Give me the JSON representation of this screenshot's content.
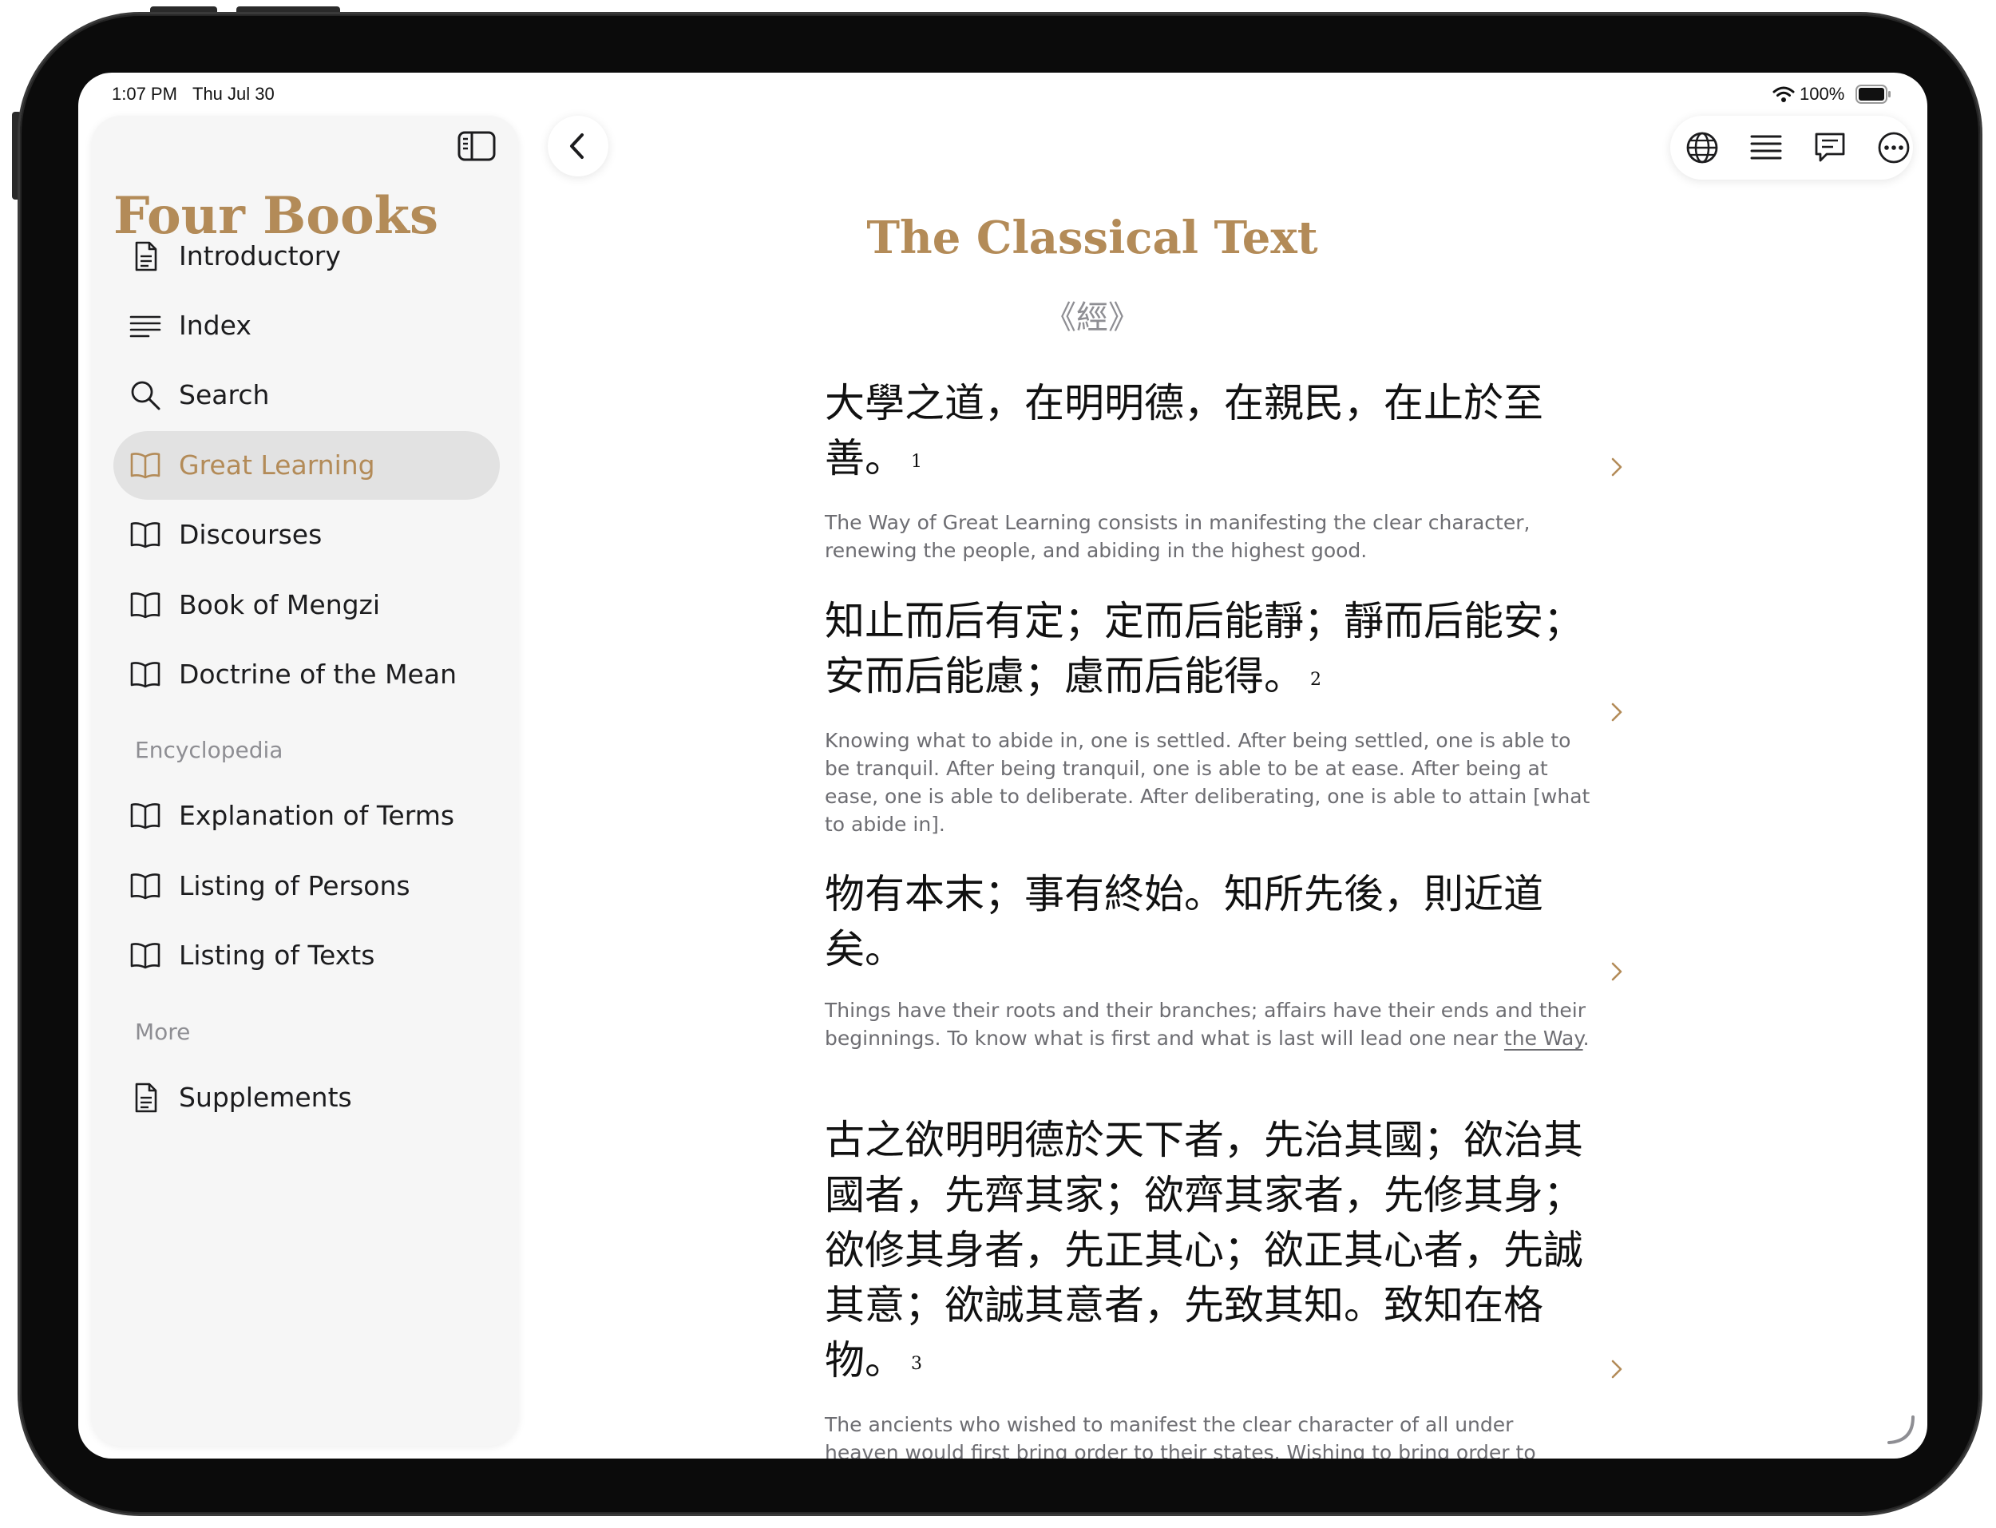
{
  "status_bar": {
    "time": "1:07 PM",
    "date": "Thu Jul 30",
    "battery": "100%"
  },
  "sidebar": {
    "title": "Four Books",
    "items": [
      {
        "label": "Introductory",
        "icon": "document-icon"
      },
      {
        "label": "Index",
        "icon": "list-icon"
      },
      {
        "label": "Search",
        "icon": "search-icon"
      },
      {
        "label": "Great Learning",
        "icon": "book-icon",
        "selected": true
      },
      {
        "label": "Discourses",
        "icon": "book-icon"
      },
      {
        "label": "Book of Mengzi",
        "icon": "book-icon"
      },
      {
        "label": "Doctrine of the Mean",
        "icon": "book-icon"
      }
    ],
    "encyclopedia_header": "Encyclopedia",
    "encyclopedia_items": [
      {
        "label": "Explanation of Terms",
        "icon": "book-icon"
      },
      {
        "label": "Listing of Persons",
        "icon": "book-icon"
      },
      {
        "label": "Listing of Texts",
        "icon": "book-icon"
      }
    ],
    "more_header": "More",
    "more_items": [
      {
        "label": "Supplements",
        "icon": "document-icon"
      }
    ]
  },
  "toolbar": {
    "icons": [
      "back-chevron-icon",
      "globe-icon",
      "text-align-icon",
      "comment-icon",
      "more-icon"
    ]
  },
  "document": {
    "title": "The Classical Text",
    "subtitle": "《經》",
    "verses": [
      {
        "zh": "大學之道，在明明德，在親民，在止於至善。",
        "fn": "1",
        "en": "The Way of Great Learning consists in manifesting the clear character, renewing the people, and abiding in the highest good."
      },
      {
        "zh": "知止而后有定；定而后能靜；靜而后能安；安而后能慮；慮而后能得。",
        "fn": "2",
        "en": "Knowing what to abide in, one is settled. After being settled, one is able to be tranquil. After being tranquil, one is able to be at ease. After being at ease, one is able to deliberate. After deliberating, one is able to attain [what to abide in]."
      },
      {
        "zh": "物有本末；事有終始。知所先後，則近道矣。",
        "fn": "",
        "en_pre": "Things have their roots and their branches; affairs have their ends and their beginnings. To know what is first and what is last will lead one near ",
        "en_link": "the Way",
        "en_post": "."
      },
      {
        "zh": "古之欲明明德於天下者，先治其國；欲治其國者，先齊其家；欲齊其家者，先修其身；欲修其身者，先正其心；欲正其心者，先誠其意；欲誠其意者，先致其知。致知在格物。",
        "fn": "3",
        "en": "The ancients who wished to manifest the clear character of all under heaven would first bring order to their states. Wishing to bring order to"
      }
    ]
  },
  "colors": {
    "accent": "#b38b58",
    "selected_bg": "#e2e2e2",
    "secondary_text": "#6d6d72",
    "bezel": "#0b0b0b"
  }
}
